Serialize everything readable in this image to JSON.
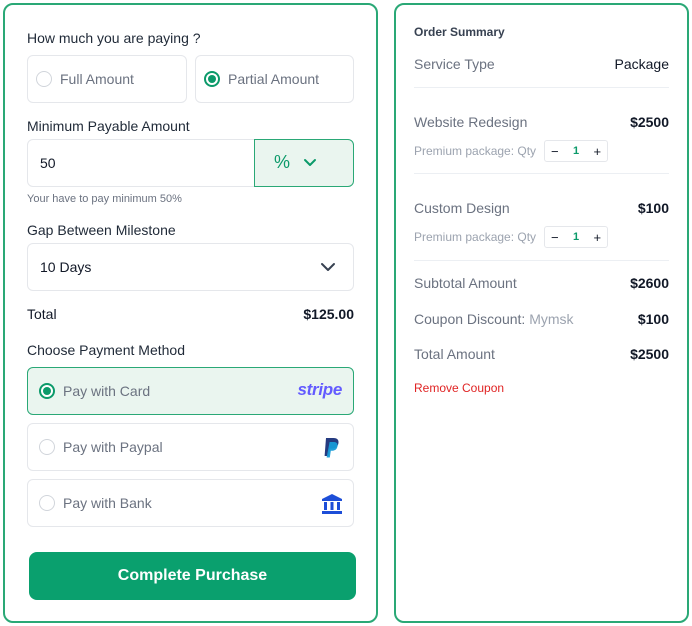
{
  "checkout": {
    "paying_question": "How much you are paying ?",
    "payment_options": [
      {
        "label": "Full Amount",
        "selected": false
      },
      {
        "label": "Partial Amount",
        "selected": true
      }
    ],
    "min_payable_label": "Minimum Payable Amount",
    "min_payable_value": "50",
    "unit_symbol": "%",
    "min_hint": "Your have to pay minimum 50%",
    "gap_label": "Gap Between Milestone",
    "gap_value": "10 Days",
    "total_label": "Total",
    "total_value": "$125.00",
    "method_label": "Choose Payment Method",
    "methods": [
      {
        "label": "Pay with Card",
        "brand": "stripe",
        "icon": "stripe-logo",
        "selected": true
      },
      {
        "label": "Pay with Paypal",
        "icon": "paypal-icon",
        "selected": false
      },
      {
        "label": "Pay with Bank",
        "icon": "bank-icon",
        "selected": false
      }
    ],
    "complete_button": "Complete Purchase"
  },
  "summary": {
    "title": "Order Summary",
    "service_type_label": "Service Type",
    "service_type_value": "Package",
    "items": [
      {
        "name": "Website Redesign",
        "price": "$2500",
        "sub_label": "Premium package: Qty",
        "qty": "1"
      },
      {
        "name": "Custom Design",
        "price": "$100",
        "sub_label": "Premium package: Qty",
        "qty": "1"
      }
    ],
    "subtotal_label": "Subtotal Amount",
    "subtotal_value": "$2600",
    "coupon_label": "Coupon Discount:",
    "coupon_code": "Mymsk",
    "coupon_value": "$100",
    "total_label": "Total Amount",
    "total_value": "$2500",
    "remove_coupon": "Remove Coupon"
  },
  "colors": {
    "accent": "#0aa06e",
    "panel_border": "#2aa876",
    "danger": "#e02424",
    "stripe": "#635bff",
    "paypal_dark": "#253b80",
    "paypal_light": "#179bd7",
    "bank": "#1d4ed8"
  }
}
